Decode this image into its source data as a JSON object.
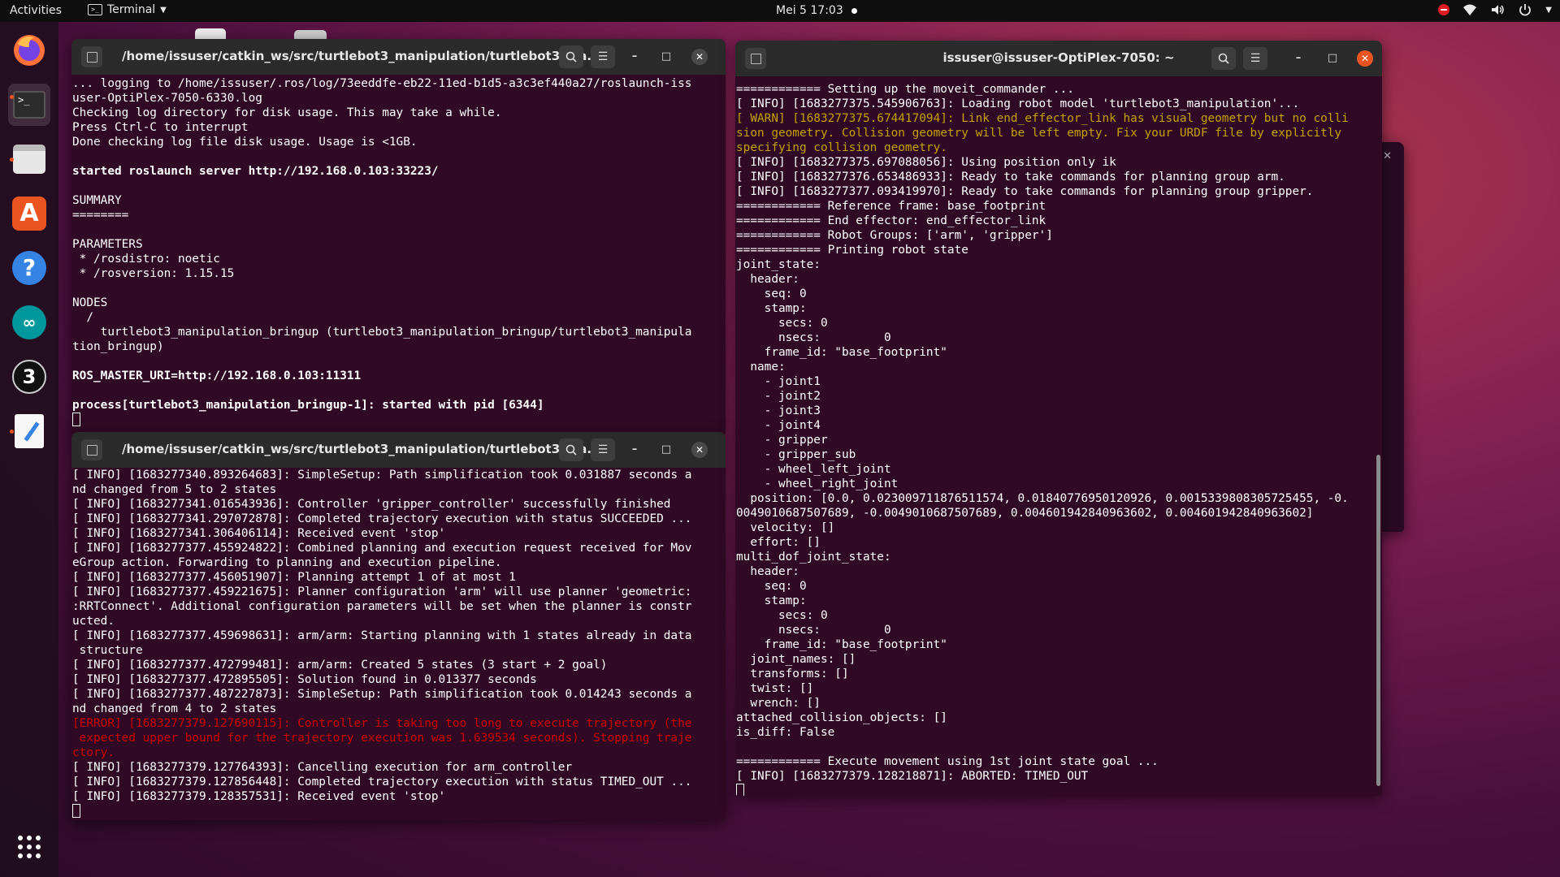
{
  "topbar": {
    "activities": "Activities",
    "app_menu": "Terminal",
    "clock": "Mei 5  17:03",
    "tray_icons": [
      "do-not-disturb-icon",
      "wifi-icon",
      "volume-icon",
      "power-icon",
      "chevron-down-icon"
    ]
  },
  "dock": {
    "apps": [
      "firefox-icon",
      "terminal-icon",
      "files-icon",
      "software-center-icon",
      "help-icon",
      "arduino-icon",
      "blender-icon",
      "text-editor-icon"
    ],
    "show_apps_icon": "app-grid-icon"
  },
  "terminal_top_left": {
    "title": "/home/issuser/catkin_ws/src/turtlebot3_manipulation/turtlebot3_ma...",
    "lines": [
      "... logging to /home/issuser/.ros/log/73eeddfe-eb22-11ed-b1d5-a3c3ef440a27/roslaunch-iss",
      "user-OptiPlex-7050-6330.log",
      "Checking log directory for disk usage. This may take a while.",
      "Press Ctrl-C to interrupt",
      "Done checking log file disk usage. Usage is <1GB.",
      "",
      "started roslaunch server http://192.168.0.103:33223/",
      "",
      "SUMMARY",
      "========",
      "",
      "PARAMETERS",
      " * /rosdistro: noetic",
      " * /rosversion: 1.15.15",
      "",
      "NODES",
      "  /",
      "    turtlebot3_manipulation_bringup (turtlebot3_manipulation_bringup/turtlebot3_manipula",
      "tion_bringup)",
      "",
      "ROS_MASTER_URI=http://192.168.0.103:11311",
      "",
      "process[turtlebot3_manipulation_bringup-1]: started with pid [6344]"
    ]
  },
  "terminal_bottom_left": {
    "title": "/home/issuser/catkin_ws/src/turtlebot3_manipulation/turtlebot3_ma...",
    "lines": [
      "[ INFO] [1683277340.893264683]: SimpleSetup: Path simplification took 0.031887 seconds a",
      "nd changed from 5 to 2 states",
      "[ INFO] [1683277341.016543936]: Controller 'gripper_controller' successfully finished",
      "[ INFO] [1683277341.297072878]: Completed trajectory execution with status SUCCEEDED ...",
      "[ INFO] [1683277341.306406114]: Received event 'stop'",
      "[ INFO] [1683277377.455924822]: Combined planning and execution request received for Mov",
      "eGroup action. Forwarding to planning and execution pipeline.",
      "[ INFO] [1683277377.456051907]: Planning attempt 1 of at most 1",
      "[ INFO] [1683277377.459221675]: Planner configuration 'arm' will use planner 'geometric:",
      ":RRTConnect'. Additional configuration parameters will be set when the planner is constr",
      "ucted.",
      "[ INFO] [1683277377.459698631]: arm/arm: Starting planning with 1 states already in data",
      " structure",
      "[ INFO] [1683277377.472799481]: arm/arm: Created 5 states (3 start + 2 goal)",
      "[ INFO] [1683277377.472895505]: Solution found in 0.013377 seconds",
      "[ INFO] [1683277377.487227873]: SimpleSetup: Path simplification took 0.014243 seconds a",
      "nd changed from 4 to 2 states",
      "[ERROR] [1683277379.127690115]: Controller is taking too long to execute trajectory (the",
      " expected upper bound for the trajectory execution was 1.639534 seconds). Stopping traje",
      "ctory.",
      "[ INFO] [1683277379.127764393]: Cancelling execution for arm_controller",
      "[ INFO] [1683277379.127856448]: Completed trajectory execution with status TIMED_OUT ...",
      "[ INFO] [1683277379.128357531]: Received event 'stop'"
    ],
    "error_line_indices": [
      17,
      18,
      19
    ]
  },
  "terminal_right": {
    "title": "issuser@issuser-OptiPlex-7050: ~",
    "lines": [
      "============ Setting up the moveit_commander ...",
      "[ INFO] [1683277375.545906763]: Loading robot model 'turtlebot3_manipulation'...",
      "[ WARN] [1683277375.674417094]: Link end_effector_link has visual geometry but no colli",
      "sion geometry. Collision geometry will be left empty. Fix your URDF file by explicitly",
      "specifying collision geometry.",
      "[ INFO] [1683277375.697088056]: Using position only ik",
      "[ INFO] [1683277376.653486933]: Ready to take commands for planning group arm.",
      "[ INFO] [1683277377.093419970]: Ready to take commands for planning group gripper.",
      "============ Reference frame: base_footprint",
      "============ End effector: end_effector_link",
      "============ Robot Groups: ['arm', 'gripper']",
      "============ Printing robot state",
      "joint_state:",
      "  header:",
      "    seq: 0",
      "    stamp:",
      "      secs: 0",
      "      nsecs:         0",
      "    frame_id: \"base_footprint\"",
      "  name:",
      "    - joint1",
      "    - joint2",
      "    - joint3",
      "    - joint4",
      "    - gripper",
      "    - gripper_sub",
      "    - wheel_left_joint",
      "    - wheel_right_joint",
      "  position: [0.0, 0.023009711876511574, 0.01840776950120926, 0.0015339808305725455, -0.",
      "0049010687507689, -0.0049010687507689, 0.004601942840963602, 0.004601942840963602]",
      "  velocity: []",
      "  effort: []",
      "multi_dof_joint_state:",
      "  header:",
      "    seq: 0",
      "    stamp:",
      "      secs: 0",
      "      nsecs:         0",
      "    frame_id: \"base_footprint\"",
      "  joint_names: []",
      "  transforms: []",
      "  twist: []",
      "  wrench: []",
      "attached_collision_objects: []",
      "is_diff: False",
      "",
      "============ Execute movement using 1st joint state goal ...",
      "[ INFO] [1683277379.128218871]: ABORTED: TIMED_OUT"
    ],
    "warn_line_indices": [
      2,
      3,
      4
    ]
  },
  "colors": {
    "terminal_bg": "#300a24",
    "header_bg": "#2b2b2b",
    "warn": "#c4a000",
    "error": "#cc0000",
    "accent": "#e95420"
  }
}
